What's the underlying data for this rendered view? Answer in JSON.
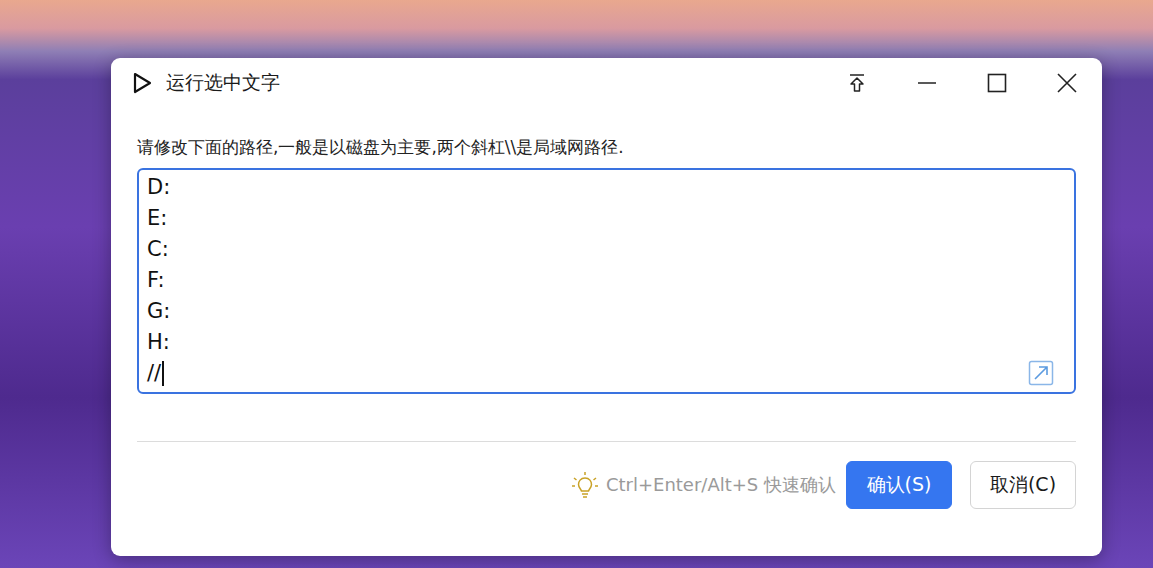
{
  "window": {
    "title": "运行选中文字"
  },
  "instruction": "请修改下面的路径,一般是以磁盘为主要,两个斜杠\\\\是局域网路径.",
  "textarea": {
    "lines": [
      "D:",
      "E:",
      "C:",
      "F:",
      "G:",
      "H:",
      "//"
    ],
    "focused": true
  },
  "hint": "Ctrl+Enter/Alt+S 快速确认",
  "buttons": [
    {
      "label": "确认(S)",
      "primary": true
    },
    {
      "label": "取消(C)",
      "primary": false
    }
  ]
}
